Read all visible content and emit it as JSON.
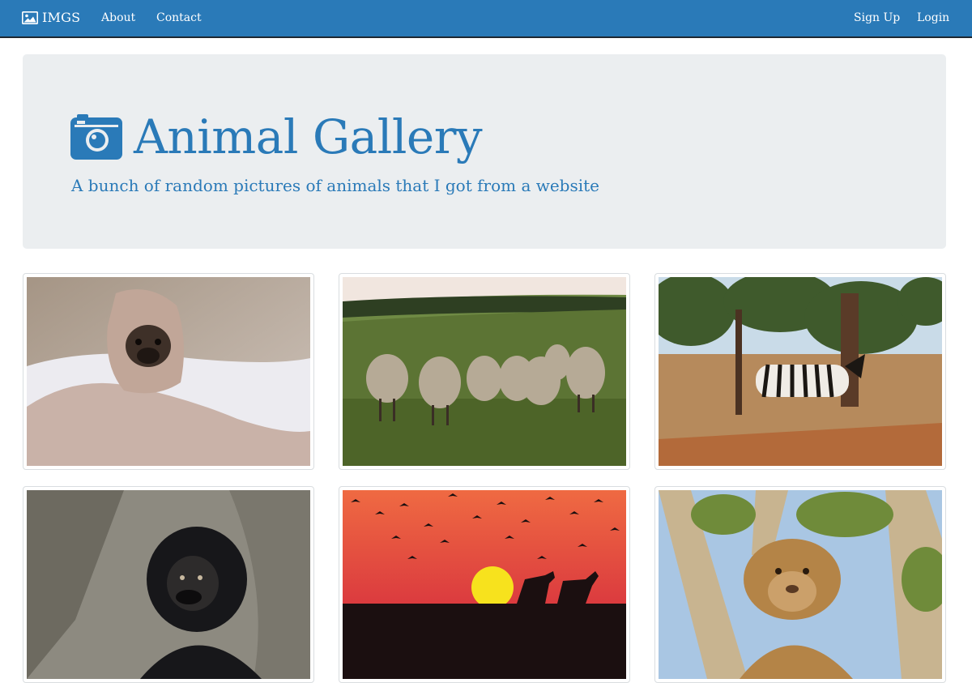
{
  "navbar": {
    "brand": "IMGS",
    "links": [
      "About",
      "Contact"
    ],
    "right_links": [
      "Sign Up",
      "Login"
    ],
    "color": "#2a7ab8"
  },
  "jumbotron": {
    "title": "Animal Gallery",
    "subtitle": "A bunch of random pictures of animals that I got from a website",
    "icon": "camera-icon"
  },
  "gallery": [
    {
      "name": "pug-photo",
      "subject": "pug-in-blanket"
    },
    {
      "name": "sheep-photo",
      "subject": "sheep-flock"
    },
    {
      "name": "zebra-photo",
      "subject": "zebra-savanna"
    },
    {
      "name": "gorilla-photo",
      "subject": "gorilla"
    },
    {
      "name": "sunset-photo",
      "subject": "horses-sunset-birds"
    },
    {
      "name": "lioness-photo",
      "subject": "lioness-in-tree"
    }
  ]
}
